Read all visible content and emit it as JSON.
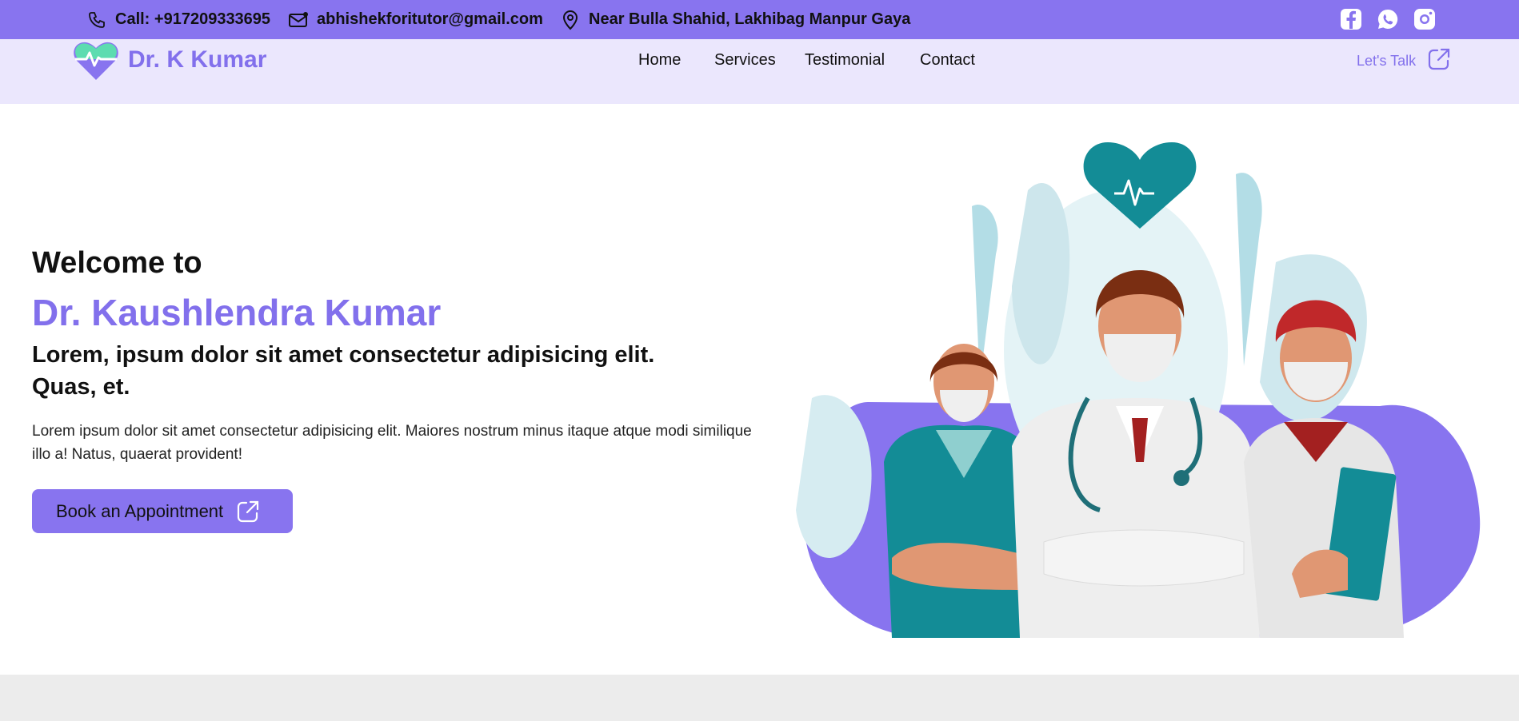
{
  "topbar": {
    "phone": "Call: +917209333695",
    "email": "abhishekforitutor@gmail.com",
    "address": "Near Bulla Shahid, Lakhibag Manpur Gaya",
    "socials": [
      "facebook-icon",
      "whatsapp-icon",
      "instagram-icon"
    ]
  },
  "nav": {
    "brand": "Dr. K Kumar",
    "links": [
      "Home",
      "Services",
      "Testimonial",
      "Contact"
    ],
    "cta": "Let's Talk"
  },
  "hero": {
    "welcome": "Welcome to",
    "name": "Dr. Kaushlendra Kumar",
    "tagline": "Lorem, ipsum dolor sit amet consectetur adipisicing elit. Quas, et.",
    "description": "Lorem ipsum dolor sit amet consectetur adipisicing elit. Maiores nostrum minus itaque atque modi similique illo a! Natus, quaerat provident!",
    "button": "Book an Appointment"
  },
  "colors": {
    "accent": "#8874ef",
    "brand": "#8270ec",
    "nav_bg": "#ebe7fd",
    "teal": "#138c96"
  }
}
